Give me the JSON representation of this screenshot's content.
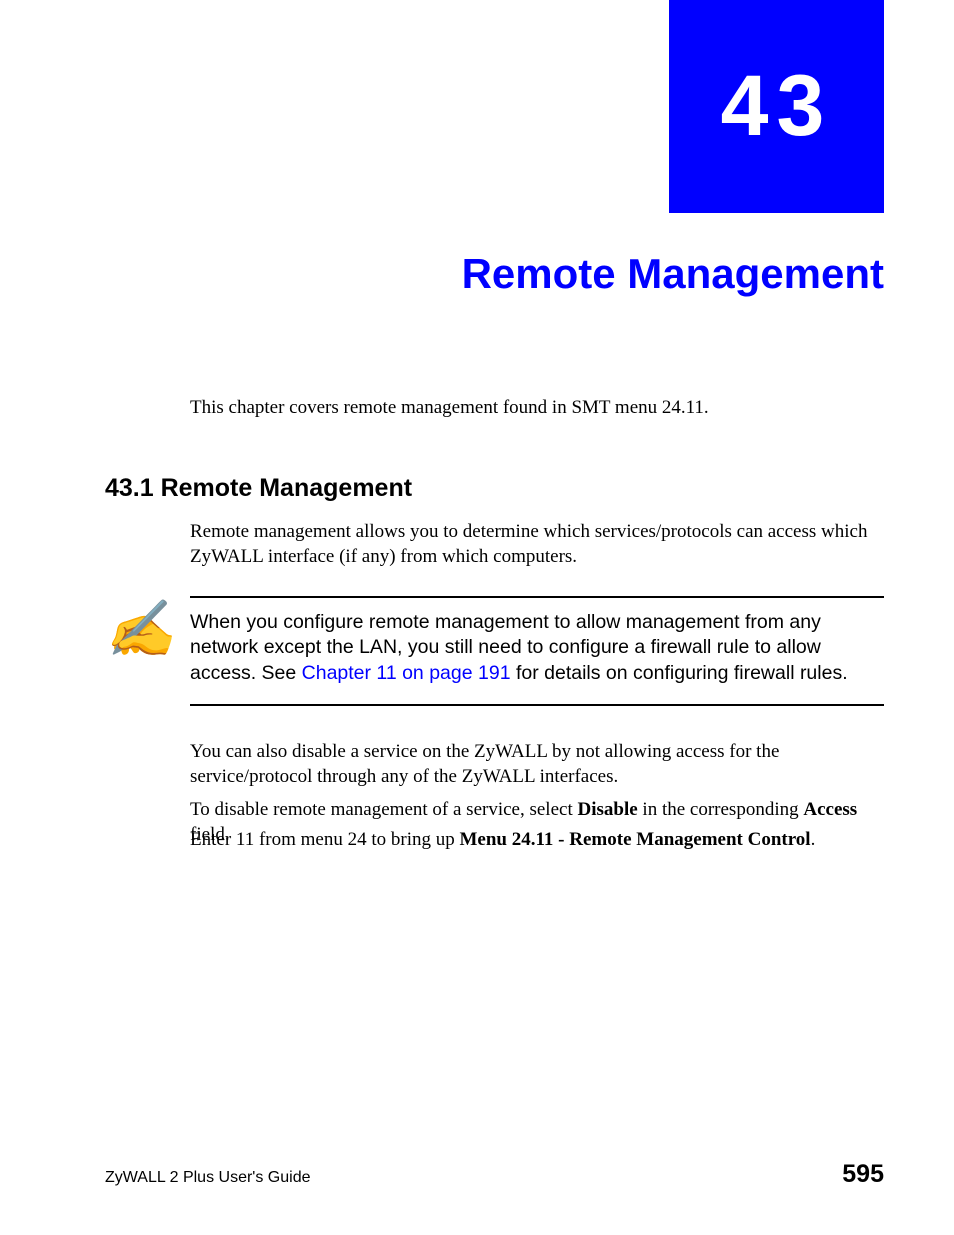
{
  "chapter": {
    "number": "43",
    "title": "Remote Management"
  },
  "intro": "This chapter covers remote management found in SMT menu 24.11.",
  "section": {
    "heading": "43.1  Remote Management",
    "intro": "Remote management allows you to determine which services/protocols can access which ZyWALL interface (if any) from which computers."
  },
  "note": {
    "text_before_link": "When you configure remote management to allow management from any network except the LAN, you still need to configure a firewall rule to allow access. See ",
    "link_text": "Chapter 11 on page 191",
    "text_after_link": " for details on configuring firewall rules."
  },
  "body": {
    "p1": "You can also disable a service on the ZyWALL by not allowing access for the service/protocol through any of the ZyWALL interfaces.",
    "p2_before": "To disable remote management of a service, select ",
    "p2_bold1": "Disable",
    "p2_mid": " in the corresponding ",
    "p2_bold2": "Access",
    "p2_after": " field.",
    "p3_before": "Enter 11 from menu 24 to bring up ",
    "p3_bold": "Menu 24.11 - Remote Management Control",
    "p3_after": "."
  },
  "footer": {
    "guide": "ZyWALL 2 Plus User's Guide",
    "page": "595"
  }
}
